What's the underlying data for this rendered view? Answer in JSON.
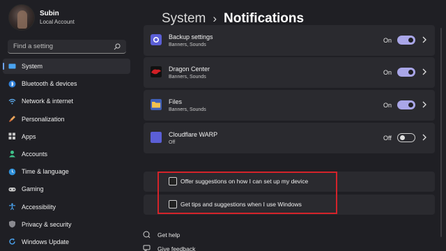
{
  "profile": {
    "name": "Subin",
    "account_type": "Local Account"
  },
  "search": {
    "placeholder": "Find a setting"
  },
  "sidebar": {
    "items": [
      {
        "label": "System",
        "icon": "monitor-icon",
        "active": true
      },
      {
        "label": "Bluetooth & devices",
        "icon": "bluetooth-icon"
      },
      {
        "label": "Network & internet",
        "icon": "wifi-icon"
      },
      {
        "label": "Personalization",
        "icon": "brush-icon"
      },
      {
        "label": "Apps",
        "icon": "apps-icon"
      },
      {
        "label": "Accounts",
        "icon": "person-icon"
      },
      {
        "label": "Time & language",
        "icon": "globe-clock-icon"
      },
      {
        "label": "Gaming",
        "icon": "gamepad-icon"
      },
      {
        "label": "Accessibility",
        "icon": "accessibility-icon"
      },
      {
        "label": "Privacy & security",
        "icon": "shield-icon"
      },
      {
        "label": "Windows Update",
        "icon": "update-icon"
      }
    ]
  },
  "header": {
    "parent": "System",
    "separator": "›",
    "current": "Notifications"
  },
  "apps": [
    {
      "name": "Backup settings",
      "subtitle": "Banners, Sounds",
      "state": "On",
      "enabled": true,
      "icon": "gear-icon"
    },
    {
      "name": "Dragon Center",
      "subtitle": "Banners, Sounds",
      "state": "On",
      "enabled": true,
      "icon": "dragon-icon"
    },
    {
      "name": "Files",
      "subtitle": "Banners, Sounds",
      "state": "On",
      "enabled": true,
      "icon": "folder-icon"
    },
    {
      "name": "Cloudflare WARP",
      "subtitle": "Off",
      "state": "Off",
      "enabled": false,
      "icon": "cloudflare-icon"
    }
  ],
  "suggestions": [
    {
      "label": "Offer suggestions on how I can set up my device",
      "checked": false
    },
    {
      "label": "Get tips and suggestions when I use Windows",
      "checked": false
    }
  ],
  "links": {
    "help": "Get help",
    "feedback": "Give feedback"
  },
  "colors": {
    "accent": "#a9a6e8",
    "highlight_border": "#d4232a",
    "nav_indicator": "#6ea4ff"
  }
}
